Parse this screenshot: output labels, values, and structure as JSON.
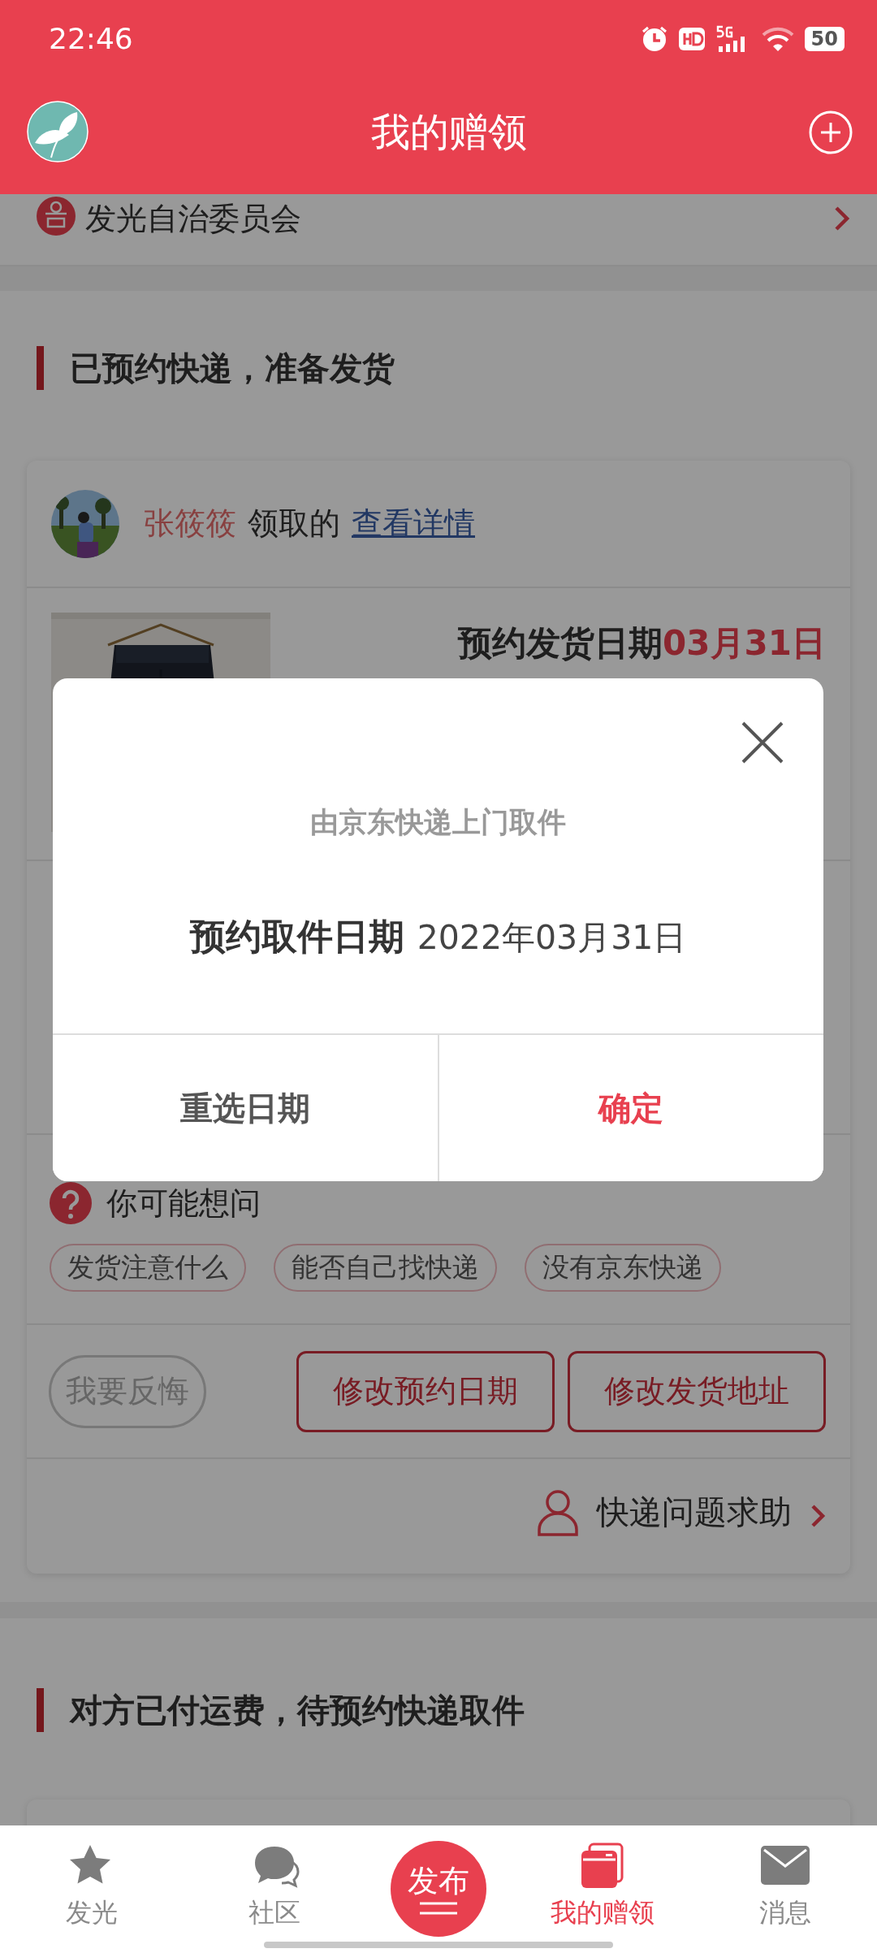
{
  "status_bar": {
    "time": "22:46",
    "battery": "50"
  },
  "header": {
    "title": "我的赠领"
  },
  "committee": {
    "name": "发光自治委员会"
  },
  "sections": [
    {
      "title": "已预约快递，准备发货",
      "card": {
        "claimer": "张筱筱",
        "claimed_text": "领取的",
        "details_link": "查看详情",
        "ship_label": "预约发货日期",
        "ship_date": "03月31日",
        "questions_title": "你可能想问",
        "chips": [
          "发货注意什么",
          "能否自己找快递",
          "没有京东快递"
        ],
        "actions": [
          {
            "label": "我要反悔",
            "disabled": true
          },
          {
            "label": "修改预约日期",
            "disabled": false
          },
          {
            "label": "修改发货地址",
            "disabled": false
          }
        ],
        "help": "快递问题求助"
      }
    },
    {
      "title": "对方已付运费，待预约快递取件"
    }
  ],
  "dialog": {
    "subtitle": "由京东快递上门取件",
    "label": "预约取件日期",
    "date": "2022年03月31日",
    "buttons": [
      {
        "label": "重选日期",
        "kind": "secondary"
      },
      {
        "label": "确定",
        "kind": "primary"
      }
    ]
  },
  "nav": [
    {
      "label": "发光",
      "kind": "tab",
      "selected": false
    },
    {
      "label": "社区",
      "kind": "tab",
      "selected": false
    },
    {
      "label": "发布",
      "kind": "publish",
      "selected": false
    },
    {
      "label": "我的赠领",
      "kind": "tab",
      "selected": true
    },
    {
      "label": "消息",
      "kind": "tab",
      "selected": false
    }
  ]
}
